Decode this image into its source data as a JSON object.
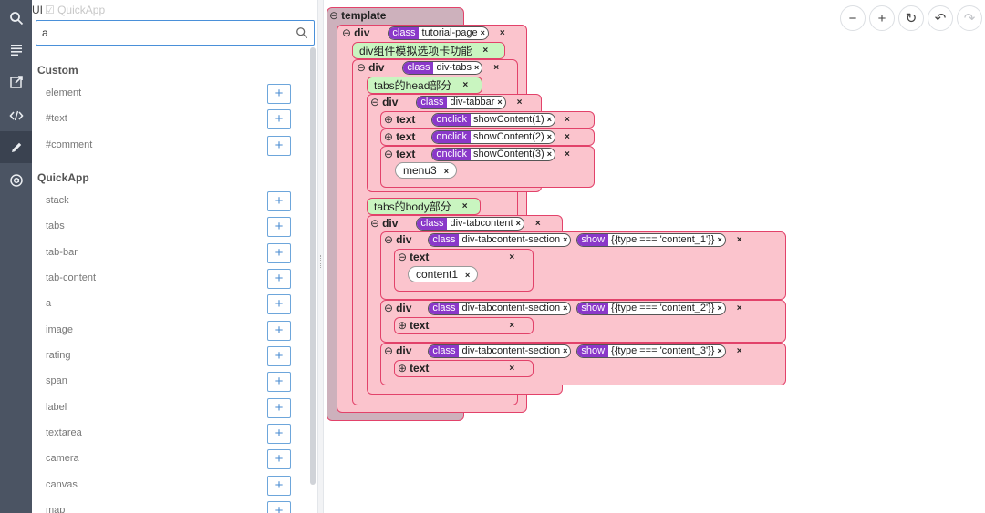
{
  "header": {
    "ui_label": "UI",
    "checkbox_label": "QuickApp"
  },
  "search": {
    "value": "a",
    "placeholder": ""
  },
  "groups": [
    {
      "title": "Custom",
      "items": [
        "element",
        "#text",
        "#comment"
      ]
    },
    {
      "title": "QuickApp",
      "items": [
        "stack",
        "tabs",
        "tab-bar",
        "tab-content",
        "a",
        "image",
        "rating",
        "span",
        "label",
        "textarea",
        "camera",
        "canvas",
        "map"
      ]
    }
  ],
  "add_label": "+",
  "toolbar": {
    "zoom_out": "−",
    "zoom_in": "+",
    "reset": "↻",
    "undo": "↶",
    "redo": "↷"
  },
  "tree": {
    "root": "template",
    "collapse_glyph": "⊖",
    "expand_glyph": "⊕",
    "close_glyph": "×",
    "nodes": [
      {
        "kw": "div",
        "attrs": [
          {
            "k": "class",
            "v": "tutorial-page"
          }
        ]
      },
      {
        "comment": "div组件模拟选项卡功能"
      },
      {
        "kw": "div",
        "attrs": [
          {
            "k": "class",
            "v": "div-tabs"
          }
        ]
      },
      {
        "comment": "tabs的head部分"
      },
      {
        "kw": "div",
        "attrs": [
          {
            "k": "class",
            "v": "div-tabbar"
          }
        ]
      },
      {
        "kw": "text",
        "attrs": [
          {
            "k": "onclick",
            "v": "showContent(1)"
          }
        ]
      },
      {
        "kw": "text",
        "attrs": [
          {
            "k": "onclick",
            "v": "showContent(2)"
          }
        ]
      },
      {
        "kw": "text",
        "attrs": [
          {
            "k": "onclick",
            "v": "showContent(3)"
          }
        ]
      },
      {
        "value": "menu3"
      },
      {
        "comment": "tabs的body部分"
      },
      {
        "kw": "div",
        "attrs": [
          {
            "k": "class",
            "v": "div-tabcontent"
          }
        ]
      },
      {
        "kw": "div",
        "attrs": [
          {
            "k": "class",
            "v": "div-tabcontent-section"
          },
          {
            "k": "show",
            "v": "{{type === 'content_1'}}"
          }
        ]
      },
      {
        "kw": "text",
        "attrs": []
      },
      {
        "value": "content1"
      },
      {
        "kw": "div",
        "attrs": [
          {
            "k": "class",
            "v": "div-tabcontent-section"
          },
          {
            "k": "show",
            "v": "{{type === 'content_2'}}"
          }
        ]
      },
      {
        "kw": "text",
        "attrs": []
      },
      {
        "kw": "div",
        "attrs": [
          {
            "k": "class",
            "v": "div-tabcontent-section"
          },
          {
            "k": "show",
            "v": "{{type === 'content_3'}}"
          }
        ]
      },
      {
        "kw": "text",
        "attrs": []
      }
    ]
  }
}
